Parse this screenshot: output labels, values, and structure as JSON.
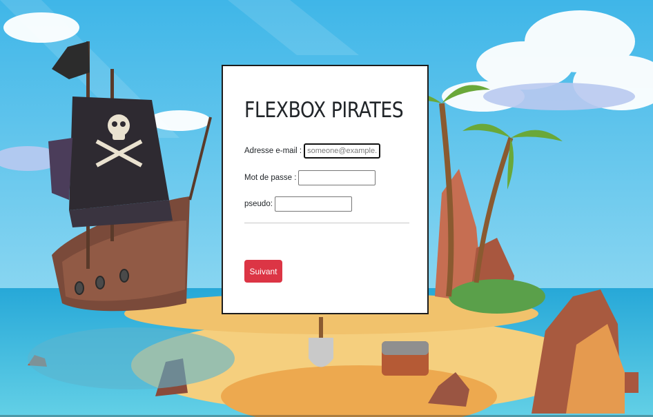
{
  "form": {
    "title": "FLEXBOX PIRATES",
    "email_label": "Adresse e-mail :",
    "email_placeholder": "someone@example.com",
    "email_value": "",
    "password_label": "Mot de passe :",
    "password_value": "",
    "pseudo_label": "pseudo:",
    "pseudo_value": "",
    "submit_label": "Suivant"
  },
  "colors": {
    "submit_button": "#dc3545",
    "sky": "#5ec3ea",
    "sea": "#2bb0d6",
    "sand": "#f3c77a"
  }
}
